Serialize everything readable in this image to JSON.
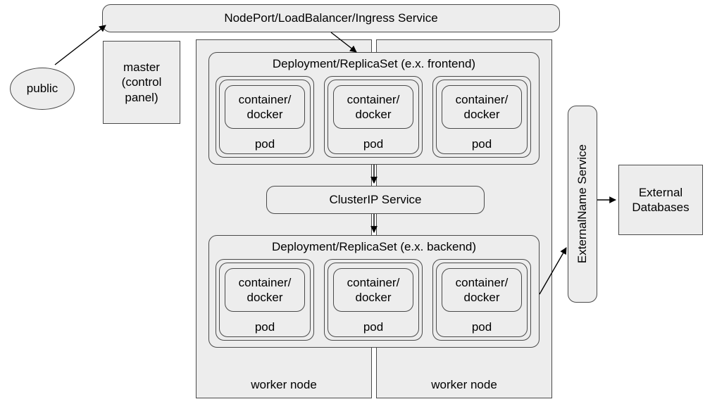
{
  "public": "public",
  "master": {
    "l1": "master",
    "l2": "(control",
    "l3": "panel)"
  },
  "ingress": "NodePort/LoadBalancer/Ingress Service",
  "worker_node": "worker node",
  "deploy_frontend": "Deployment/ReplicaSet (e.x. frontend)",
  "deploy_backend": "Deployment/ReplicaSet  (e.x. backend)",
  "clusterip": "ClusterIP Service",
  "pod": "pod",
  "container": {
    "l1": "container/",
    "l2": "docker"
  },
  "externalname": "ExternalName Service",
  "external_db": {
    "l1": "External",
    "l2": "Databases"
  }
}
